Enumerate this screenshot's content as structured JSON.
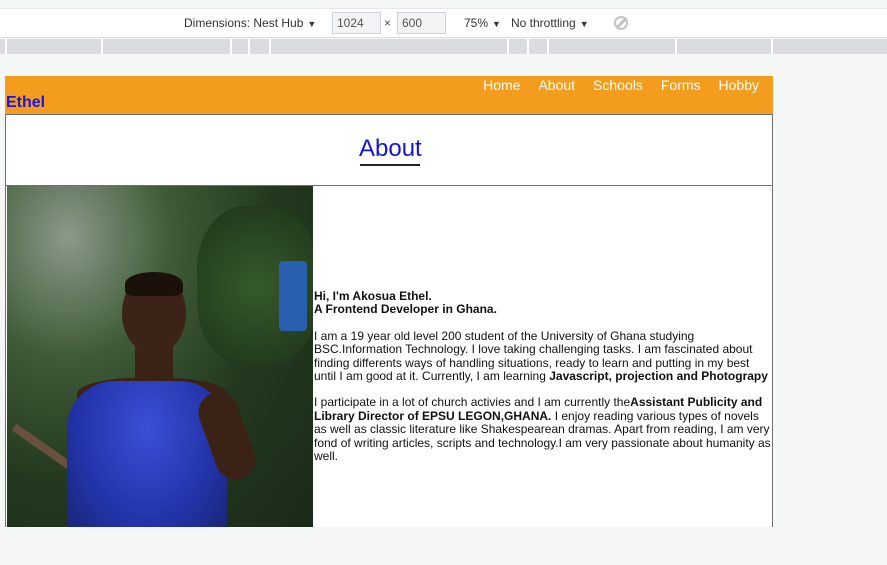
{
  "devtools": {
    "dimensions_label": "Dimensions: Nest Hub",
    "width_value": "1024",
    "times": "×",
    "height_value": "600",
    "zoom": "75%",
    "throttling": "No throttling"
  },
  "site": {
    "brand": "Ethel",
    "nav": [
      "Home",
      "About",
      "Schools",
      "Forms",
      "Hobby"
    ]
  },
  "about": {
    "title": "About"
  },
  "bio": {
    "greeting": "Hi, I'm Akosua Ethel.",
    "role": "A Frontend Developer in Ghana.",
    "para1_text": "I am a 19 year old level 200 student of the University of Ghana studying BSC.Information Technology. I love taking challenging tasks. I am fascinated about finding differents ways of handling situations, ready to learn and putting in my best until I am good at it. Currently, I am learning ",
    "para1_bold": "Javascript, projection and Photograpy",
    "para2_text": "I participate in a lot of church activies and I am currently the",
    "para2_bold": "Assistant Publicity and Library Director of EPSU LEGON,GHANA.",
    "para2_rest": " I enjoy reading various types of novels as well as classic literature like Shakespearean dramas. Apart from reading, I am very fond of writing articles, scripts and technology.I am very passionate about humanity as well."
  },
  "icons": {
    "dropdown": "chevron-down-icon",
    "rotate": "rotate-icon"
  }
}
